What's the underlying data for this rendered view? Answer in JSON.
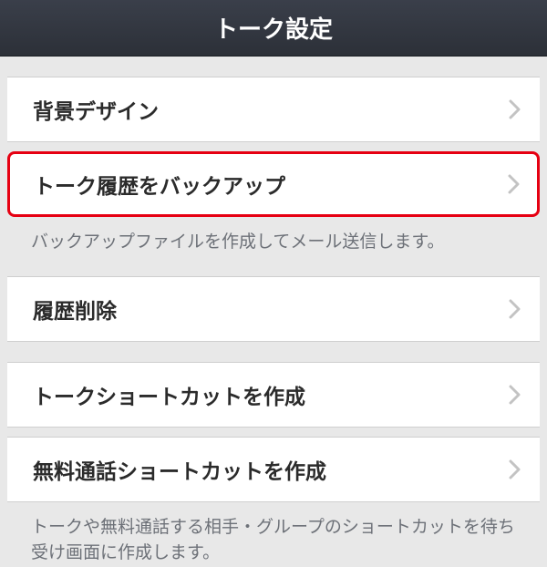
{
  "header": {
    "title": "トーク設定"
  },
  "groups": [
    {
      "items": [
        {
          "label": "背景デザイン",
          "highlighted": false
        },
        {
          "label": "トーク履歴をバックアップ",
          "highlighted": true
        }
      ],
      "footer": "バックアップファイルを作成してメール送信します。"
    },
    {
      "items": [
        {
          "label": "履歴削除",
          "highlighted": false
        }
      ],
      "footer": ""
    },
    {
      "items": [
        {
          "label": "トークショートカットを作成",
          "highlighted": false
        },
        {
          "label": "無料通話ショートカットを作成",
          "highlighted": false
        }
      ],
      "footer": "トークや無料通話する相手・グループのショートカットを待ち受け画面に作成します。"
    }
  ]
}
